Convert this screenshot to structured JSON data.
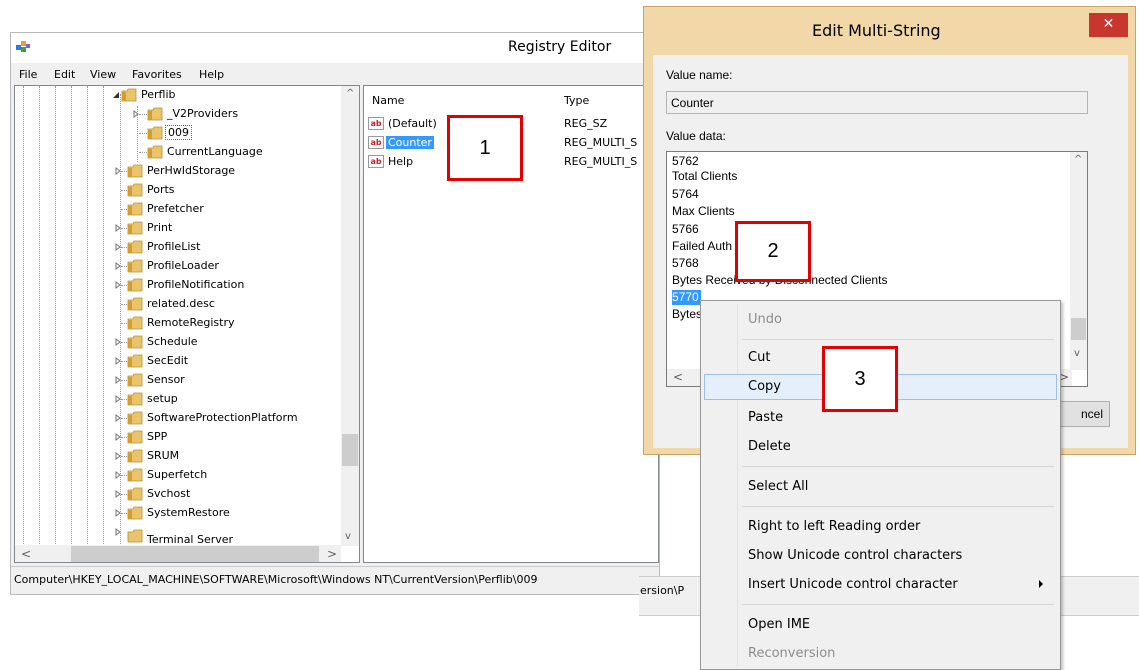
{
  "regedit": {
    "title": "Registry Editor",
    "menu": [
      "File",
      "Edit",
      "View",
      "Favorites",
      "Help"
    ],
    "tree": {
      "items": [
        {
          "label": "Perflib",
          "expanded": true
        },
        {
          "label": "_V2Providers"
        },
        {
          "label": "009",
          "selected": true
        },
        {
          "label": "CurrentLanguage"
        },
        {
          "label": "PerHwIdStorage"
        },
        {
          "label": "Ports"
        },
        {
          "label": "Prefetcher"
        },
        {
          "label": "Print"
        },
        {
          "label": "ProfileList"
        },
        {
          "label": "ProfileLoader"
        },
        {
          "label": "ProfileNotification"
        },
        {
          "label": "related.desc"
        },
        {
          "label": "RemoteRegistry"
        },
        {
          "label": "Schedule"
        },
        {
          "label": "SecEdit"
        },
        {
          "label": "Sensor"
        },
        {
          "label": "setup"
        },
        {
          "label": "SoftwareProtectionPlatform"
        },
        {
          "label": "SPP"
        },
        {
          "label": "SRUM"
        },
        {
          "label": "Superfetch"
        },
        {
          "label": "Svchost"
        },
        {
          "label": "SystemRestore"
        },
        {
          "label": "Terminal Server"
        }
      ]
    },
    "list": {
      "col_name": "Name",
      "col_type": "Type",
      "rows": [
        {
          "name": "(Default)",
          "type": "REG_SZ"
        },
        {
          "name": "Counter",
          "type": "REG_MULTI_S",
          "selected": true
        },
        {
          "name": "Help",
          "type": "REG_MULTI_S"
        }
      ],
      "icon_text": "ab"
    },
    "status": "Computer\\HKEY_LOCAL_MACHINE\\SOFTWARE\\Microsoft\\Windows NT\\CurrentVersion\\Perflib\\009"
  },
  "dialog": {
    "title": "Edit Multi-String",
    "close_symbol": "✕",
    "value_name_label": "Value name:",
    "value_name": "Counter",
    "value_data_label": "Value data:",
    "value_data_lines": [
      "5762",
      "Total Clients",
      "5764",
      "Max Clients",
      "5766",
      "Failed Auth",
      "5768",
      "Bytes Received by Disconnected Clients",
      "5770",
      "Bytes"
    ],
    "cancel_partial": "ncel"
  },
  "bg_window": {
    "status_partial": "ersion\\P"
  },
  "context_menu": {
    "items": [
      {
        "label": "Undo",
        "disabled": true
      },
      {
        "label": "Cut"
      },
      {
        "label": "Copy",
        "hover": true
      },
      {
        "label": "Paste"
      },
      {
        "label": "Delete"
      },
      {
        "label": "Select All"
      },
      {
        "label": "Right to left Reading order"
      },
      {
        "label": "Show Unicode control characters"
      },
      {
        "label": "Insert Unicode control character",
        "submenu": true
      },
      {
        "label": "Open IME"
      },
      {
        "label": "Reconversion",
        "disabled": true
      }
    ]
  },
  "annotations": [
    "1",
    "2",
    "3"
  ],
  "colors": {
    "selection": "#3399ff",
    "annotation_border": "#e20000",
    "dialog_frame": "#f2d8a8",
    "close_button": "#c7372f",
    "menu_hover": "#e5effb"
  }
}
